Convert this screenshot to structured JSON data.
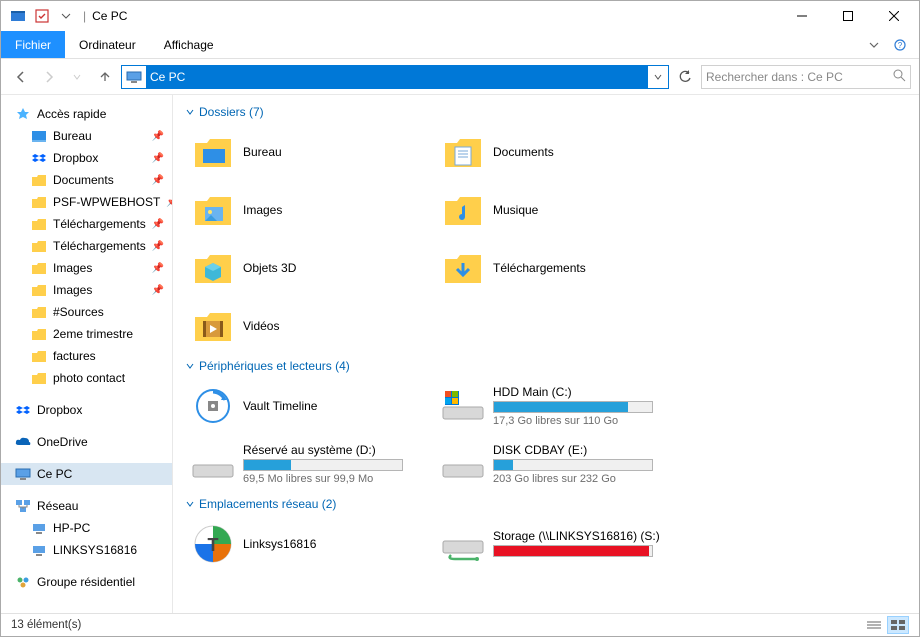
{
  "title": "Ce PC",
  "ribbon": {
    "file": "Fichier",
    "computer": "Ordinateur",
    "view": "Affichage"
  },
  "address": {
    "value": "Ce PC"
  },
  "search": {
    "placeholder": "Rechercher dans : Ce PC"
  },
  "sidebar": {
    "quick_access": "Accès rapide",
    "items": [
      "Bureau",
      "Dropbox",
      "Documents",
      "PSF-WPWEBHOST",
      "Téléchargements",
      "Téléchargements",
      "Images",
      "Images",
      "#Sources",
      "2eme trimestre",
      "factures",
      "photo contact"
    ],
    "dropbox": "Dropbox",
    "onedrive": "OneDrive",
    "thispc": "Ce PC",
    "network": "Réseau",
    "network_items": [
      "HP-PC",
      "LINKSYS16816"
    ],
    "homegroup": "Groupe résidentiel"
  },
  "groups": {
    "folders": {
      "header": "Dossiers (7)",
      "items": [
        "Bureau",
        "Documents",
        "Images",
        "Musique",
        "Objets 3D",
        "Téléchargements",
        "Vidéos"
      ]
    },
    "devices": {
      "header": "Périphériques et lecteurs (4)",
      "items": [
        {
          "name": "Vault Timeline",
          "type": "timeline"
        },
        {
          "name": "HDD Main (C:)",
          "sub": "17,3 Go libres sur 110 Go",
          "fill": 85,
          "color": "blue"
        },
        {
          "name": "Réservé au système (D:)",
          "sub": "69,5 Mo libres sur 99,9 Mo",
          "fill": 30,
          "color": "blue"
        },
        {
          "name": "DISK CDBAY (E:)",
          "sub": "203 Go libres sur 232 Go",
          "fill": 12,
          "color": "blue"
        }
      ]
    },
    "network": {
      "header": "Emplacements réseau (2)",
      "items": [
        {
          "name": "Linksys16816",
          "type": "logo"
        },
        {
          "name": "Storage (\\\\LINKSYS16816) (S:)",
          "sub": "",
          "fill": 98,
          "color": "red"
        }
      ]
    }
  },
  "status": {
    "count": "13 élément(s)"
  }
}
